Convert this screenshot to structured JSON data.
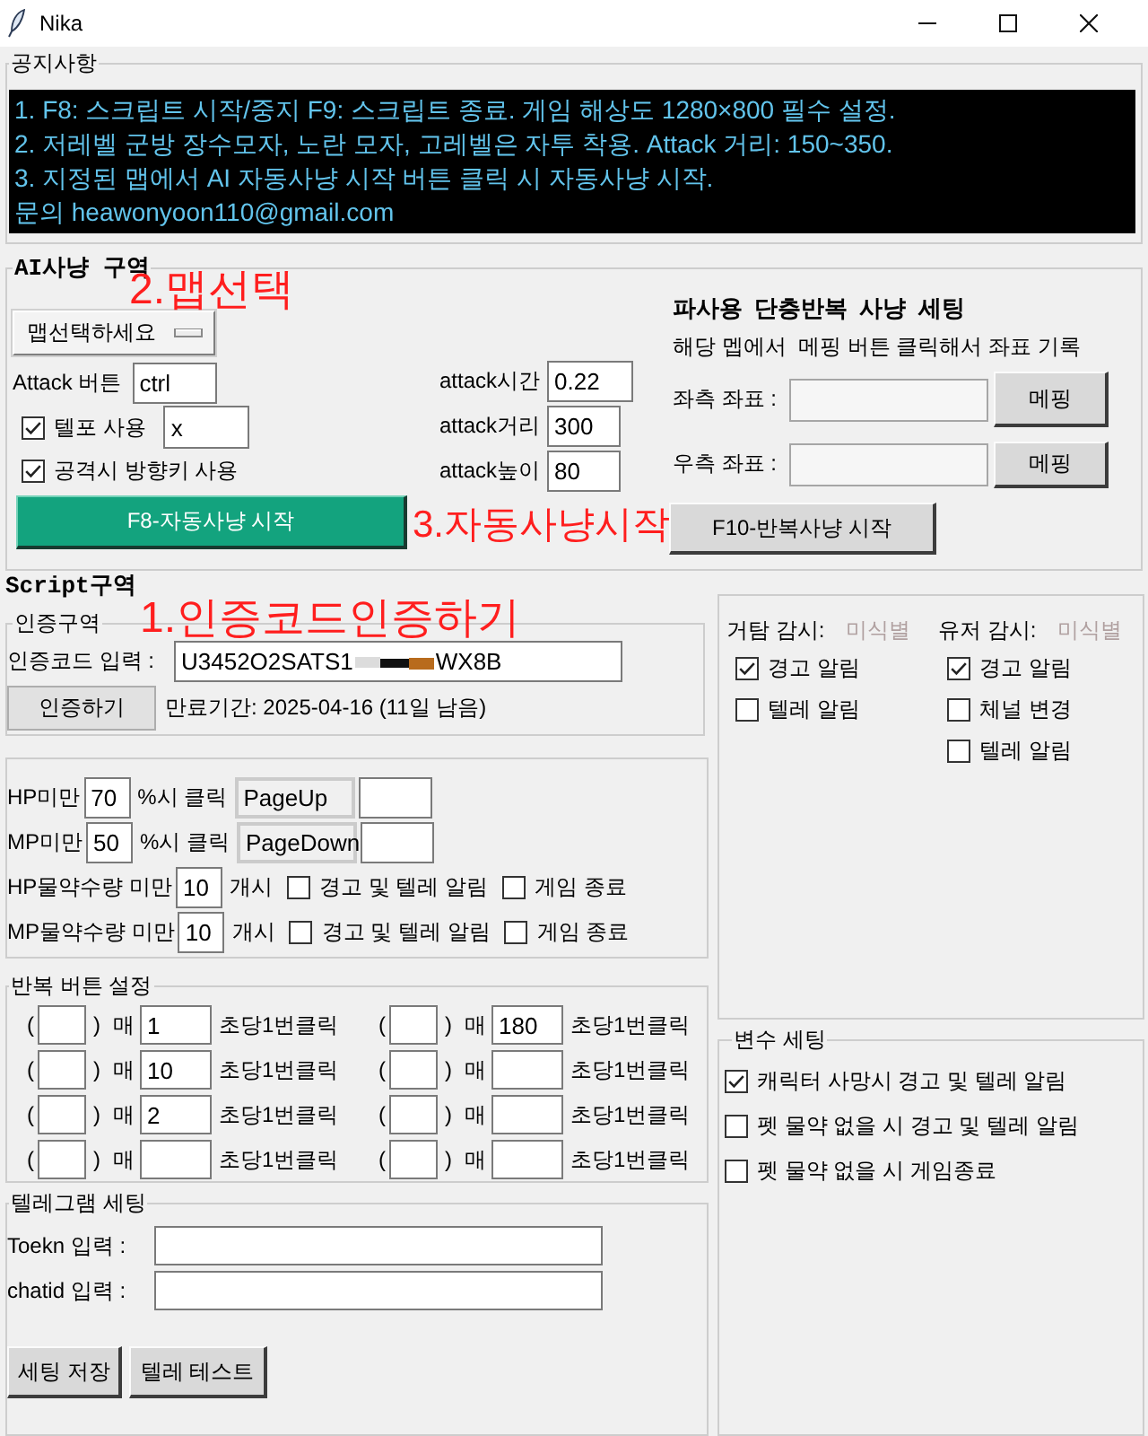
{
  "window": {
    "title": "Nika"
  },
  "notice": {
    "title": "공지사항",
    "lines": [
      "1. F8: 스크립트 시작/중지 F9: 스크립트 종료. 게임 해상도 1280×800 필수 설정.",
      "2. 저레벨 군방 장수모자, 노란 모자, 고레벨은 자투 착용. Attack 거리: 150~350.",
      "3. 지정된 맵에서 AI 자동사냥 시작 버튼 클릭 시 자동사냥 시작.",
      "문의 heawonyoon110@gmail.com"
    ]
  },
  "ai_hunting": {
    "title": "AI사냥 구역",
    "map_menu": "맵선택하세요",
    "attack_key": {
      "label": "Attack 버튼",
      "value": "ctrl"
    },
    "options": [
      {
        "kind": "checkbox_entry",
        "label": "텔포 사용",
        "checked": true,
        "value": "x"
      },
      {
        "kind": "checkbox",
        "label": "공격시 방향키 사용",
        "checked": true
      }
    ],
    "start_button": "F8-자동사냥 시작",
    "params": [
      {
        "label": "attack시간",
        "value": "0.22"
      },
      {
        "label": "attack거리",
        "value": "300"
      },
      {
        "label": "attack높이",
        "value": "80"
      }
    ],
    "repeat_hunt": {
      "title": "파사용 단층반복 사냥 세팅",
      "hint": "해당 멥에서  메핑 버튼 클릭해서 좌표 기록",
      "coords": [
        {
          "label": "좌측 좌표 :",
          "button": "메핑"
        },
        {
          "label": "우측 좌표 :",
          "button": "메핑"
        }
      ],
      "start_button": "F10-반복사냥 시작"
    },
    "annotations": [
      {
        "kind": "map",
        "text": "2.맵선택"
      },
      {
        "kind": "start",
        "text": "3.자동사냥시작"
      }
    ]
  },
  "script": {
    "title": "Script구역",
    "auth": {
      "title": "인증구역",
      "note": "1.인증코드인증하기",
      "label": "인증코드 입력 :",
      "code_start": "U3452O2SATS1",
      "code_end": "WX8B",
      "button": "인증하기",
      "expiry": "만료기간: 2025-04-16 (11일 남음)"
    },
    "potions": [
      {
        "kind": "percent",
        "label": "HP미만",
        "value": "70",
        "suffix": "%시 클릭",
        "key": "PageUp"
      },
      {
        "kind": "percent",
        "label": "MP미만",
        "value": "50",
        "suffix": "%시 클릭",
        "key": "PageDown"
      },
      {
        "kind": "count",
        "label": "HP물약수량 미만",
        "value": "10",
        "suffix": "개시",
        "checks": [
          {
            "label": "경고 및 텔레 알림",
            "checked": false
          },
          {
            "label": "게임 종료",
            "checked": false
          }
        ]
      },
      {
        "kind": "count",
        "label": "MP물약수량 미만",
        "value": "10",
        "suffix": "개시",
        "checks": [
          {
            "label": "경고 및 텔레 알림",
            "checked": false
          },
          {
            "label": "게임 종료",
            "checked": false
          }
        ]
      }
    ],
    "repeat_buttons": {
      "title": "반복 버튼 설정",
      "slots": [
        {
          "open": "(",
          "close": ")",
          "each": "매",
          "seconds": "1",
          "unit": "초당1번클릭"
        },
        {
          "open": "(",
          "close": ")",
          "each": "매",
          "seconds": "180",
          "unit": "초당1번클릭"
        },
        {
          "open": "(",
          "close": ")",
          "each": "매",
          "seconds": "10",
          "unit": "초당1번클릭"
        },
        {
          "open": "(",
          "close": ")",
          "each": "매",
          "unit": "초당1번클릭"
        },
        {
          "open": "(",
          "close": ")",
          "each": "매",
          "seconds": "2",
          "unit": "초당1번클릭"
        },
        {
          "open": "(",
          "close": ")",
          "each": "매",
          "unit": "초당1번클릭"
        },
        {
          "open": "(",
          "close": ")",
          "each": "매",
          "unit": "초당1번클릭"
        },
        {
          "open": "(",
          "close": ")",
          "each": "매",
          "unit": "초당1번클릭"
        }
      ]
    },
    "telegram": {
      "title": "텔레그램 세팅",
      "fields": [
        {
          "label": "Toekn 입력 :"
        },
        {
          "label": "chatid 입력 :"
        }
      ],
      "buttons": [
        "세팅 저장",
        "텔레 테스트"
      ]
    }
  },
  "monitor": {
    "columns": [
      {
        "label": "거탐 감시:",
        "status": "미식별",
        "checks": [
          {
            "label": "경고 알림",
            "checked": true
          },
          {
            "label": "텔레 알림",
            "checked": false
          }
        ]
      },
      {
        "label": "유저 감시:",
        "status": "미식별",
        "checks": [
          {
            "label": "경고 알림",
            "checked": true
          },
          {
            "label": "체널 변경",
            "checked": false
          },
          {
            "label": "텔레 알림",
            "checked": false
          }
        ]
      }
    ]
  },
  "variables": {
    "title": "변수 세팅",
    "checks": [
      {
        "label": "캐릭터 사망시 경고 및 텔레 알림",
        "checked": true
      },
      {
        "label": "펫 물약 없을 시 경고 및 텔레 알림",
        "checked": false
      },
      {
        "label": "펫 물약 없을 시 게임종료",
        "checked": false
      }
    ]
  }
}
